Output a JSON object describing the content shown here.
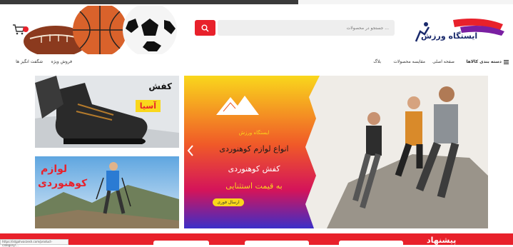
{
  "colors": {
    "brand_red": "#e8212b",
    "brand_navy": "#1a2a6c",
    "hero_yellow": "#f9d71c",
    "hero_blue": "#3b2ec8"
  },
  "header": {
    "logo_text": "ایستگاه ورزش",
    "search_placeholder": "جستجو در محصولات ...",
    "search_icon": "search-icon",
    "cart_icon": "cart-icon"
  },
  "nav": {
    "menu_icon": "hamburger-menu-icon",
    "items": [
      {
        "label": "دسته بندی کالاها"
      },
      {
        "label": "صفحه اصلی"
      },
      {
        "label": "مقایسه محصولات"
      },
      {
        "label": "بلاگ"
      },
      {
        "label": "فروش ویژه"
      },
      {
        "label": "شگفت انگیز ها"
      }
    ]
  },
  "banners": {
    "shoes": {
      "title": "کفش",
      "brand": "آسیا"
    },
    "gear": {
      "title_line1": "لوازم",
      "title_line2": "کوهنوردی"
    }
  },
  "hero": {
    "brand": "ایستگاه ورزش",
    "line1": "انواع لوازم کوهنوردی",
    "line2": "کفش کوهنوردی",
    "line3": "به قیمت استثنایی",
    "cta": "ارسال فوری",
    "prev_icon": "chevron-left-icon"
  },
  "bottom": {
    "title": "پیشنهاد",
    "url_status": "https://istgahvarzesh.com/product-category/..."
  }
}
